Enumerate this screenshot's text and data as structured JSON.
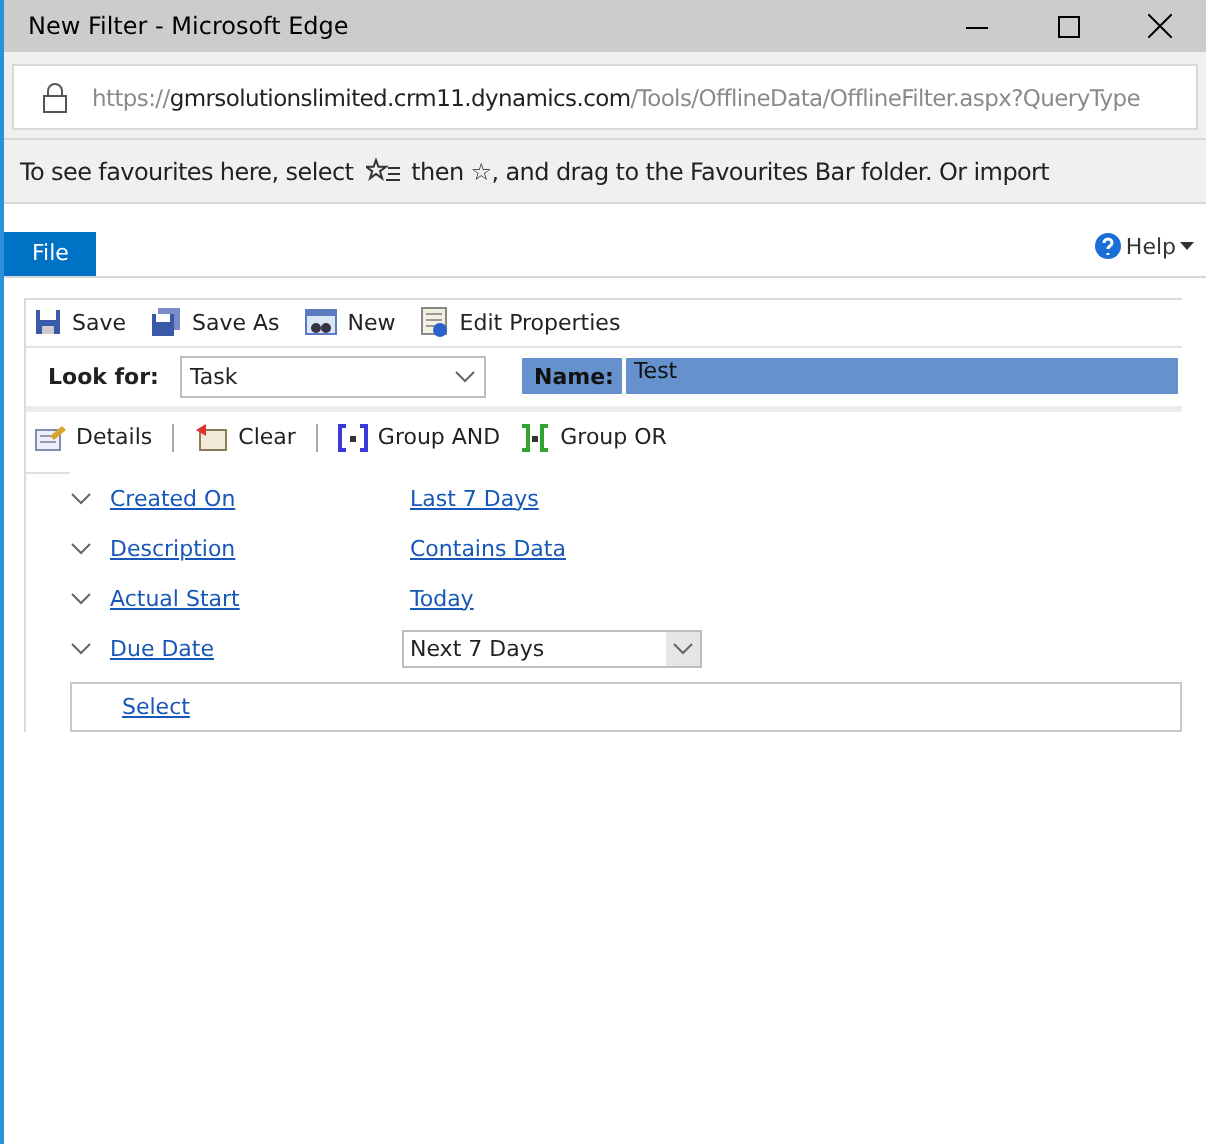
{
  "window": {
    "title": "New Filter - Microsoft Edge"
  },
  "address": {
    "scheme": "https://",
    "host": "gmrsolutionslimited.crm11.dynamics.com",
    "path": "/Tools/OfflineData/OfflineFilter.aspx?QueryType"
  },
  "favourites_bar": {
    "before": "To see favourites here, select",
    "after": "then ☆, and drag to the Favourites Bar folder. Or import"
  },
  "ribbon_tabs": [
    {
      "label": "File",
      "selected": true
    }
  ],
  "help": "Help",
  "toolbar": [
    {
      "kind": "save",
      "label": "Save"
    },
    {
      "kind": "saveas",
      "label": "Save As"
    },
    {
      "kind": "new",
      "label": "New"
    },
    {
      "kind": "props",
      "label": "Edit Properties"
    }
  ],
  "look_for": {
    "label": "Look for:",
    "value": "Task"
  },
  "name": {
    "label": "Name:",
    "value": "Test"
  },
  "filter_toolbar": [
    {
      "kind": "details",
      "label": "Details"
    },
    {
      "kind": "clear",
      "label": "Clear"
    },
    {
      "kind": "and",
      "label": "Group AND"
    },
    {
      "kind": "or",
      "label": "Group OR"
    }
  ],
  "conditions": [
    {
      "field": "Created On",
      "kind": "link",
      "operator": "Last 7 Days"
    },
    {
      "field": "Description",
      "kind": "link",
      "operator": "Contains Data"
    },
    {
      "field": "Actual Start",
      "kind": "link",
      "operator": "Today"
    },
    {
      "field": "Due Date",
      "kind": "dropdown",
      "operator": "Next 7 Days"
    }
  ],
  "select": "Select"
}
